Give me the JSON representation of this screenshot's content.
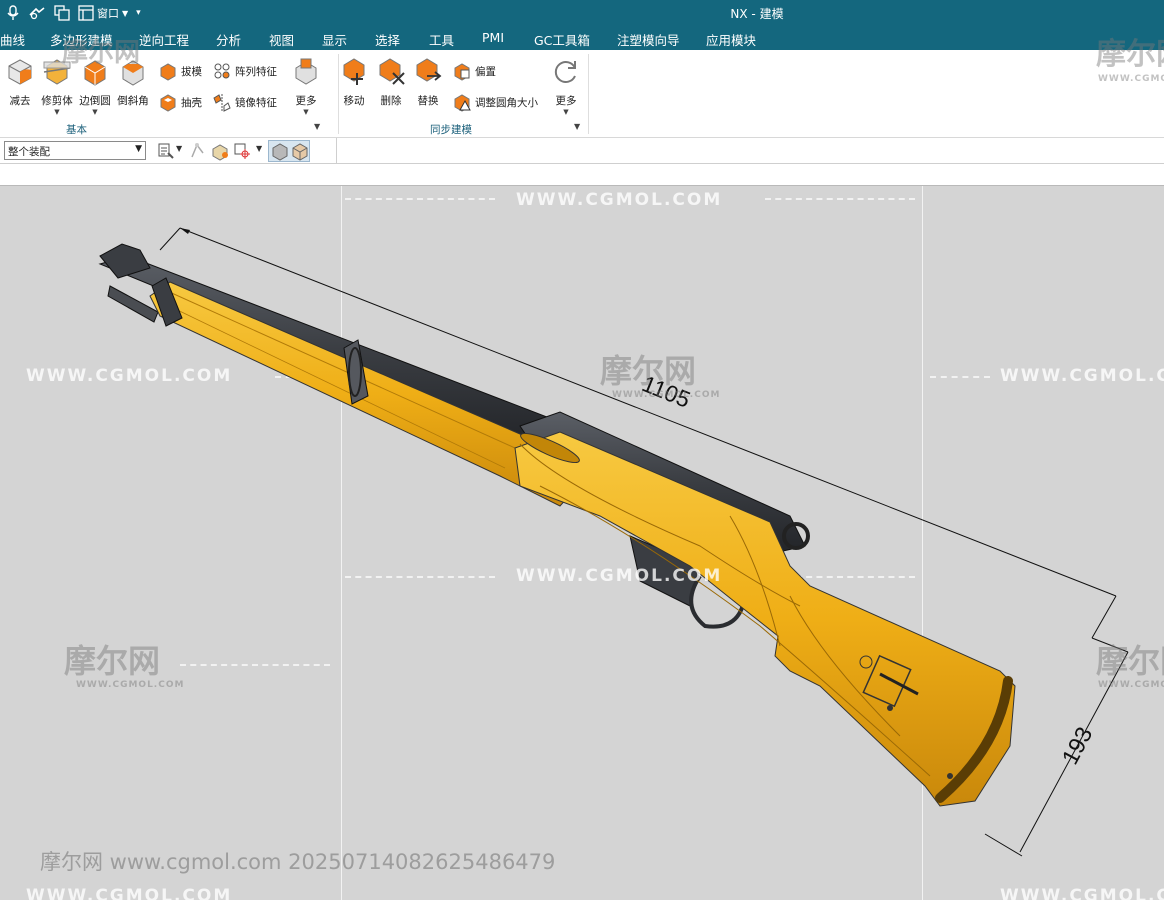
{
  "titlebar": {
    "window_menu_label": "窗口",
    "app_title": "NX - 建模"
  },
  "menu": {
    "items": [
      "曲线",
      "多边形建模",
      "逆向工程",
      "分析",
      "视图",
      "显示",
      "选择",
      "工具",
      "PMI",
      "GC工具箱",
      "注塑模向导",
      "应用模块"
    ]
  },
  "ribbon": {
    "basic_group": {
      "label": "基本",
      "subtract": "减去",
      "trim_body": "修剪体",
      "edge_blend": "边倒圆",
      "chamfer": "倒斜角",
      "draft": "拔模",
      "shell": "抽壳",
      "pattern_feature": "阵列特征",
      "mirror_feature": "镜像特征",
      "more": "更多"
    },
    "sync_group": {
      "label": "同步建模",
      "move": "移动",
      "delete": "删除",
      "replace": "替换",
      "offset": "偏置",
      "resize_blend": "调整圆角大小",
      "more": "更多"
    }
  },
  "selbar": {
    "assembly_scope": "整个装配"
  },
  "viewport": {
    "dim_length": "1105",
    "dim_height": "193",
    "watermark_url": "WWW.CGMOL.COM",
    "watermark_logo": "摩尔网",
    "watermark_logo_sub": "WWW.CGMOL.COM",
    "footer": "摩尔网 www.cgmol.com 20250714082625486479"
  },
  "colors": {
    "titlebar": "#14677e",
    "viewport_bg": "#d4d4d4",
    "stock": "#f2b41e",
    "metal": "#3a3d42",
    "group_label": "#1a5f7a"
  }
}
